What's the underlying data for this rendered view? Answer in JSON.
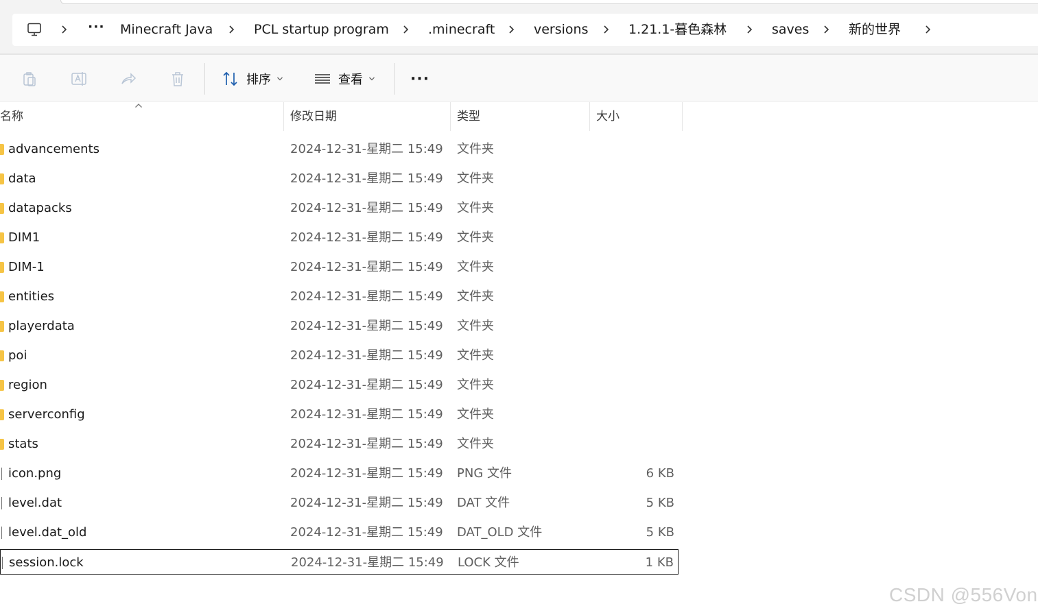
{
  "address_bar": {
    "crumbs": [
      "Minecraft Java",
      "PCL startup program",
      ".minecraft",
      "versions",
      "1.21.1-暮色森林",
      "saves",
      "新的世界"
    ],
    "overflow_label": "···",
    "root_icon": "monitor-icon",
    "separator_icon": "chevron-right-icon"
  },
  "toolbar": {
    "sort_label": "排序",
    "view_label": "查看",
    "more_label": "···",
    "icons": [
      "copy-icon",
      "rename-icon",
      "share-icon",
      "delete-icon",
      "sort-icon",
      "view-icon",
      "more-icon"
    ]
  },
  "columns": {
    "name": "名称",
    "date": "修改日期",
    "type": "类型",
    "size": "大小"
  },
  "files": [
    {
      "name": "advancements",
      "date": "2024-12-31-星期二 15:49",
      "type": "文件夹",
      "size": "",
      "kind": "folder"
    },
    {
      "name": "data",
      "date": "2024-12-31-星期二 15:49",
      "type": "文件夹",
      "size": "",
      "kind": "folder"
    },
    {
      "name": "datapacks",
      "date": "2024-12-31-星期二 15:49",
      "type": "文件夹",
      "size": "",
      "kind": "folder"
    },
    {
      "name": "DIM1",
      "date": "2024-12-31-星期二 15:49",
      "type": "文件夹",
      "size": "",
      "kind": "folder"
    },
    {
      "name": "DIM-1",
      "date": "2024-12-31-星期二 15:49",
      "type": "文件夹",
      "size": "",
      "kind": "folder"
    },
    {
      "name": "entities",
      "date": "2024-12-31-星期二 15:49",
      "type": "文件夹",
      "size": "",
      "kind": "folder"
    },
    {
      "name": "playerdata",
      "date": "2024-12-31-星期二 15:49",
      "type": "文件夹",
      "size": "",
      "kind": "folder"
    },
    {
      "name": "poi",
      "date": "2024-12-31-星期二 15:49",
      "type": "文件夹",
      "size": "",
      "kind": "folder"
    },
    {
      "name": "region",
      "date": "2024-12-31-星期二 15:49",
      "type": "文件夹",
      "size": "",
      "kind": "folder"
    },
    {
      "name": "serverconfig",
      "date": "2024-12-31-星期二 15:49",
      "type": "文件夹",
      "size": "",
      "kind": "folder"
    },
    {
      "name": "stats",
      "date": "2024-12-31-星期二 15:49",
      "type": "文件夹",
      "size": "",
      "kind": "folder"
    },
    {
      "name": "icon.png",
      "date": "2024-12-31-星期二 15:49",
      "type": "PNG 文件",
      "size": "6 KB",
      "kind": "file"
    },
    {
      "name": "level.dat",
      "date": "2024-12-31-星期二 15:49",
      "type": "DAT 文件",
      "size": "5 KB",
      "kind": "file"
    },
    {
      "name": "level.dat_old",
      "date": "2024-12-31-星期二 15:49",
      "type": "DAT_OLD 文件",
      "size": "5 KB",
      "kind": "file"
    },
    {
      "name": "session.lock",
      "date": "2024-12-31-星期二 15:49",
      "type": "LOCK 文件",
      "size": "1 KB",
      "kind": "file",
      "selected": true
    }
  ],
  "watermark": "CSDN @556Von",
  "colors": {
    "folder": "#f6c445",
    "toolbar_bg": "#f9f9f9",
    "header_bg": "#f3f3f3",
    "secondary_text": "#5f5f5f"
  }
}
